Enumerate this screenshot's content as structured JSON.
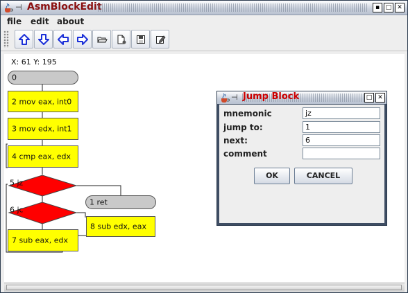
{
  "window": {
    "title": "AsmBlockEdit",
    "pin_glyph": "⊣",
    "controls": {
      "minimize": "▪",
      "maximize": "□",
      "close": "✕"
    }
  },
  "menu": {
    "items": [
      "file",
      "edit",
      "about"
    ]
  },
  "toolbar": {
    "buttons": [
      {
        "icon": "arrow-up-icon"
      },
      {
        "icon": "arrow-down-icon"
      },
      {
        "icon": "arrow-left-icon"
      },
      {
        "icon": "arrow-right-icon"
      },
      {
        "icon": "open-folder-icon"
      },
      {
        "icon": "new-document-icon"
      },
      {
        "icon": "save-icon"
      },
      {
        "icon": "edit-icon"
      }
    ]
  },
  "canvas": {
    "coordinates": "X: 61 Y: 195",
    "blocks": {
      "b0": "0",
      "b2": "2  mov eax, int0",
      "b3": "3  mov edx, int1",
      "b4": "4  cmp eax, edx",
      "b5": "5  jz",
      "b6": "6  jc",
      "b7": "7  sub eax, edx",
      "b1": "1  ret",
      "b8": "8  sub edx, eax"
    },
    "colors": {
      "instruction": "#ffff00",
      "jump": "#ff0000",
      "terminal": "#c9c9c9"
    }
  },
  "dialog": {
    "title": "Jump Block",
    "fields": {
      "mnemonic": {
        "label": "mnemonic",
        "value": "jz"
      },
      "jump_to": {
        "label": "jump to:",
        "value": "1"
      },
      "next": {
        "label": "next:",
        "value": "6"
      },
      "comment": {
        "label": "comment",
        "value": ""
      }
    },
    "ok_label": "OK",
    "cancel_label": "CANCEL"
  }
}
